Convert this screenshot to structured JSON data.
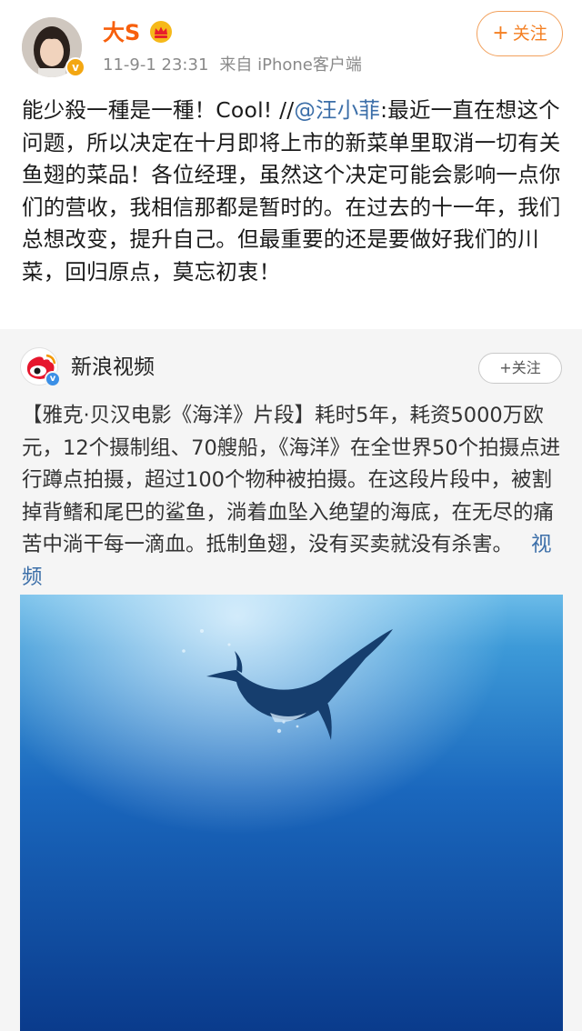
{
  "post": {
    "author": "大S",
    "verified_icon": "verified-badge-icon",
    "vip_icon": "crown-icon",
    "time": "11-9-1 23:31",
    "source": "来自 iPhone客户端",
    "follow_label": "关注",
    "text_before": "能少殺一種是一種！Cool! //",
    "mention": "@汪小菲",
    "text_after": ":最近一直在想这个问题，所以决定在十月即将上市的新菜单里取消一切有关鱼翅的菜品！各位经理，虽然这个决定可能会影响一点你们的营收，我相信那都是暂时的。在过去的十一年，我们总想改变，提升自己。但最重要的还是要做好我们的川菜，回归原点，莫忘初衷！"
  },
  "repost": {
    "author": "新浪视频",
    "follow_label": "关注",
    "text": "【雅克·贝汉电影《海洋》片段】耗时5年，耗资5000万欧元，12个摄制组、70艘船，《海洋》在全世界50个拍摄点进行蹲点拍摄，超过100个物种被拍摄。在这段片段中，被割掉背鳍和尾巴的鲨鱼，淌着血坠入绝望的海底，在无尽的痛苦中淌干每一滴血。抵制鱼翅，没有买卖就没有杀害。",
    "video_link": "视频",
    "thumbnail": "whale-underwater-image"
  },
  "colors": {
    "author_name": "#f75f0c",
    "link": "#3b6ea8",
    "follow_orange": "#f47f22",
    "card_bg": "#f5f5f5",
    "ocean_top": "#5fb3e4",
    "ocean_bottom": "#0a3d8f"
  }
}
